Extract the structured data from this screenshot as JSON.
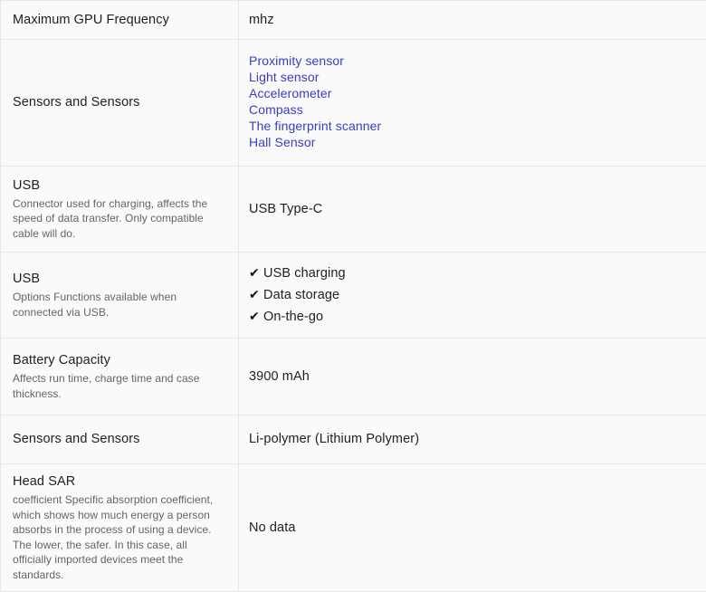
{
  "table": {
    "rows": [
      {
        "id": "max-gpu-frequency",
        "label": "Maximum GPU Frequency",
        "description": "",
        "value_type": "text",
        "value": "mhz"
      },
      {
        "id": "sensors-and-sensors",
        "label": "Sensors and Sensors",
        "description": "",
        "value_type": "links",
        "links": [
          "Proximity sensor",
          "Light sensor",
          "Accelerometer",
          "Compass",
          "The fingerprint scanner",
          "Hall Sensor"
        ]
      },
      {
        "id": "usb-connector",
        "label": "USB",
        "description": "Connector used for charging, affects the speed of data transfer. Only compatible cable will do.",
        "value_type": "text",
        "value": "USB Type-C"
      },
      {
        "id": "usb-options",
        "label": "USB",
        "description": "Options Functions available when connected via USB.",
        "value_type": "checks",
        "checks": [
          "USB charging",
          "Data storage",
          "On-the-go"
        ],
        "check_icon": "check-icon",
        "check_glyph": "✔"
      },
      {
        "id": "battery-capacity",
        "label": "Battery Capacity",
        "description": "Affects run time, charge time and case thickness.",
        "value_type": "text",
        "value": "3900 mAh"
      },
      {
        "id": "battery-type",
        "label": "Sensors and Sensors",
        "description": "",
        "value_type": "text",
        "value": "Li-polymer (Lithium Polymer)"
      },
      {
        "id": "head-sar",
        "label": "Head SAR",
        "description": "coefficient Specific absorption coefficient, which shows how much energy a person absorbs in the process of using a device. The lower, the safer. In this case, all officially imported devices meet the standards.",
        "value_type": "text",
        "value": "No data"
      }
    ]
  },
  "colors": {
    "link": "#3b3bc4",
    "text": "#202124",
    "description": "#60656b",
    "border": "#e8e8e8",
    "row_background": "#fafafa"
  }
}
